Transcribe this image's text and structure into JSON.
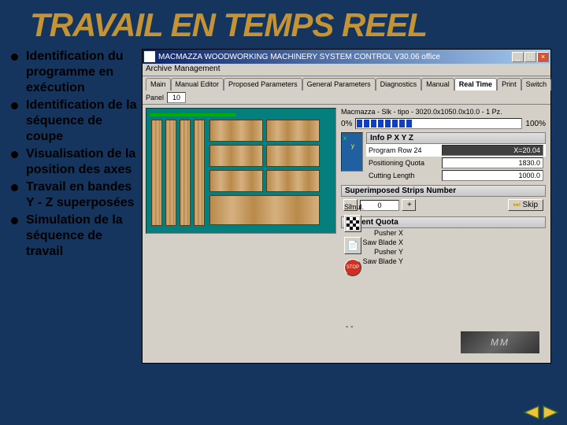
{
  "title": "TRAVAIL EN TEMPS REEL",
  "bullets": [
    "Identification du programme en exécution",
    "Identification de la séquence de coupe",
    "Visualisation de la position des axes",
    "Travail en bandes Y - Z superposées",
    "Simulation de la séquence de travail"
  ],
  "app": {
    "title": "MACMAZZA WOODWORKING MACHINERY SYSTEM CONTROL  V30.06 office",
    "menu": "Archive Management",
    "tabs": [
      "Main",
      "Manual Editor",
      "Proposed Parameters",
      "General Parameters",
      "Diagnostics",
      "Manual",
      "Real Time",
      "Print",
      "Switch"
    ],
    "active_tab": "Real Time",
    "subbar_label": "Panel",
    "subbar_value": "10",
    "program_line": "Macmazza - Slk - tipo - 3020.0x1050.0x10.0 - 1 Pz.",
    "progress_left": "0%",
    "progress_right": "100%",
    "info_heading": "Info P X Y Z",
    "rows": {
      "program_row_label": "Program Row 24",
      "program_row_value": "X=20.04",
      "positioning_label": "Positioning Quota",
      "positioning_value": "1830.0",
      "cutting_label": "Cutting Length",
      "cutting_value": "1000.0"
    },
    "simul_label": "Simul.",
    "strips_heading": "Superimposed Strips Number",
    "strips_value": "0",
    "minus": "-",
    "plus": "+",
    "skip_label": "Skip",
    "quota_heading": "Current Quota",
    "quota_rows": [
      "Pusher X",
      "Saw Blade X",
      "Pusher Y",
      "Saw Blade Y"
    ],
    "dashes": "- -",
    "logo": "MM"
  }
}
